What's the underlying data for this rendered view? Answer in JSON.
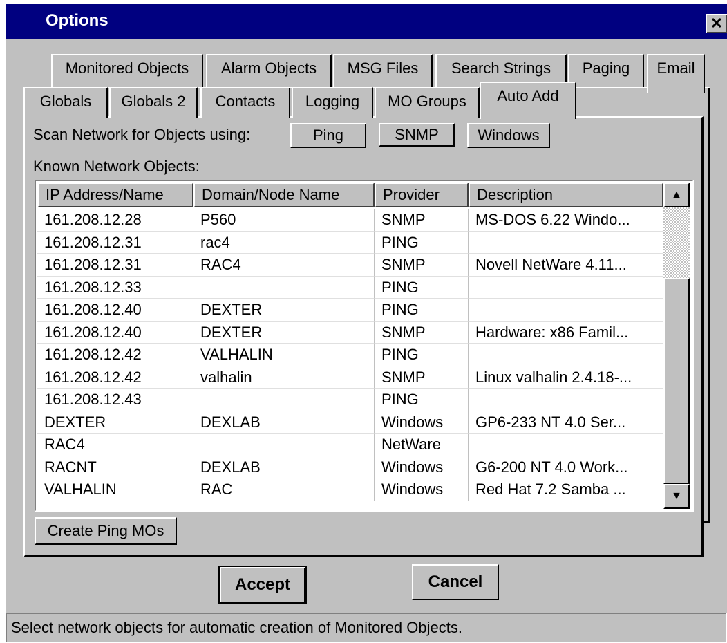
{
  "window": {
    "title": "Options",
    "close_glyph": "✕"
  },
  "tabs_back": [
    "Monitored Objects",
    "Alarm Objects",
    "MSG Files",
    "Search Strings",
    "Paging",
    "Email"
  ],
  "tabs_front": [
    "Globals",
    "Globals 2",
    "Contacts",
    "Logging",
    "MO Groups",
    "Auto Add"
  ],
  "active_tab": "Auto Add",
  "scan": {
    "label": "Scan Network for Objects using:",
    "buttons": [
      "Ping",
      "SNMP",
      "Windows"
    ]
  },
  "known_label": "Known Network Objects:",
  "table": {
    "columns": [
      "IP Address/Name",
      "Domain/Node Name",
      "Provider",
      "Description"
    ],
    "rows": [
      [
        "161.208.12.28",
        "P560",
        "SNMP",
        "MS-DOS 6.22 Windo..."
      ],
      [
        "161.208.12.31",
        "rac4",
        "PING",
        ""
      ],
      [
        "161.208.12.31",
        "RAC4",
        "SNMP",
        "Novell NetWare 4.11..."
      ],
      [
        "161.208.12.33",
        "",
        "PING",
        ""
      ],
      [
        "161.208.12.40",
        "DEXTER",
        "PING",
        ""
      ],
      [
        "161.208.12.40",
        "DEXTER",
        "SNMP",
        "Hardware: x86 Famil..."
      ],
      [
        "161.208.12.42",
        "VALHALIN",
        "PING",
        ""
      ],
      [
        "161.208.12.42",
        "valhalin",
        "SNMP",
        "Linux valhalin 2.4.18-..."
      ],
      [
        "161.208.12.43",
        "",
        "PING",
        ""
      ],
      [
        "DEXTER",
        "DEXLAB",
        "Windows",
        "GP6-233 NT 4.0 Ser..."
      ],
      [
        "RAC4",
        "",
        "NetWare",
        ""
      ],
      [
        "RACNT",
        "DEXLAB",
        "Windows",
        "G6-200 NT 4.0 Work..."
      ],
      [
        "VALHALIN",
        "RAC",
        "Windows",
        "Red Hat 7.2 Samba ..."
      ]
    ]
  },
  "scroll": {
    "up_icon": "▲",
    "down_icon": "▼"
  },
  "create_button": "Create Ping MOs",
  "accept_button": "Accept",
  "cancel_button": "Cancel",
  "status": "Select network objects for automatic creation of Monitored Objects.",
  "colors": {
    "titlebar": "#000080",
    "face": "#c0c0c0",
    "list_bg": "#ffffff"
  }
}
